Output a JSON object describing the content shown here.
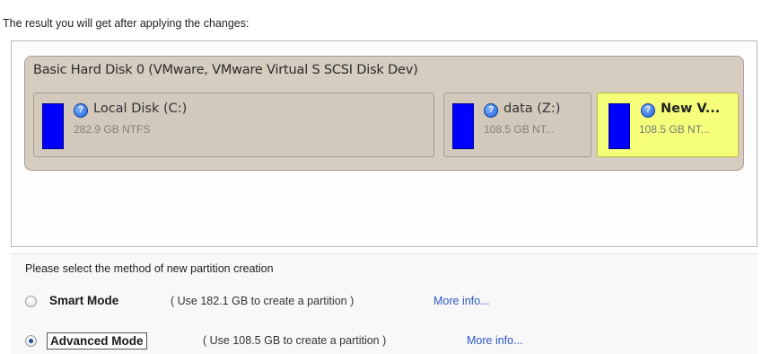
{
  "intro_text": "The result you will get after applying the changes:",
  "disk": {
    "title": "Basic Hard Disk 0 (VMware, VMware Virtual S SCSI Disk Dev)",
    "partitions": [
      {
        "name": "Local Disk (C:)",
        "size": "282.9 GB NTFS",
        "color": "#0000ff",
        "selected": false
      },
      {
        "name": "data (Z:)",
        "size": "108.5 GB NT...",
        "color": "#0000ff",
        "selected": false
      },
      {
        "name": "New V...",
        "size": "108.5 GB NT...",
        "color": "#0000ff",
        "selected": true
      }
    ],
    "help_icon": "question-icon"
  },
  "method": {
    "label": "Please select the method of new partition creation",
    "options": [
      {
        "title": "Smart Mode",
        "desc": "( Use 182.1 GB to create a partition )",
        "link": "More info...",
        "checked": false
      },
      {
        "title": "Advanced Mode",
        "desc": "( Use 108.5 GB to create a partition )",
        "link": "More info...",
        "checked": true
      }
    ]
  },
  "colors": {
    "selected_partition": "#f5ff7a",
    "disk_bg": "#d6ccbf",
    "link": "#2d57c7"
  }
}
